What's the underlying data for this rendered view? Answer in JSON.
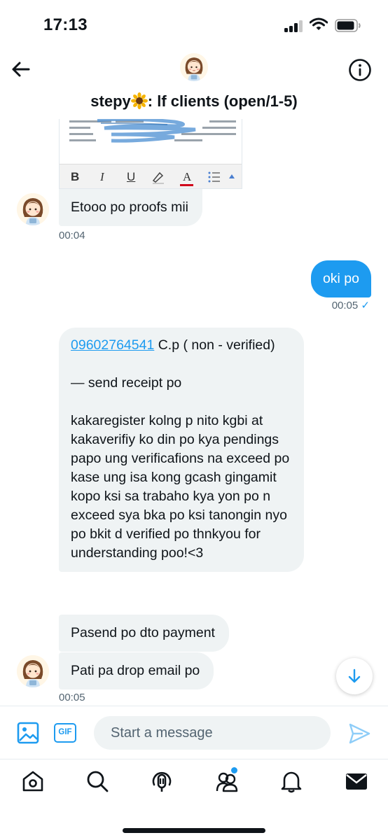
{
  "status_bar": {
    "time": "17:13"
  },
  "header": {
    "title": "stepy",
    "title_suffix": ": lf clients (open/1-5)",
    "title_emoji": "sunflower-icon"
  },
  "doc_preview": {
    "toolbar": [
      "B",
      "I",
      "U",
      "highlight",
      "A",
      "list",
      "caret"
    ]
  },
  "messages": {
    "m1": {
      "text": "Etooo po proofs mii",
      "time": "00:04"
    },
    "m2": {
      "text": "oki po",
      "time": "00:05",
      "status": "✓"
    },
    "m3": {
      "phone": "09602764541",
      "after_phone": " C.p ( non - verified)",
      "body": "— send receipt po\n\nkakaregister kolng p nito kgbi at kakaverifiy ko din po kya pendings papo ung verificafions na exceed po kase ung isa kong gcash gingamit kopo ksi sa trabaho kya yon po n exceed sya bka po ksi tanongin nyo po bkit d verified po thnkyou for understanding poo!<3"
    },
    "m4": {
      "text": "Pasend po dto payment"
    },
    "m5": {
      "text": "Pati pa drop email po",
      "time": "00:05"
    }
  },
  "composer": {
    "placeholder": "Start a message",
    "gif_label": "GIF"
  },
  "tabbar": {
    "items": [
      "home-icon",
      "search-icon",
      "spaces-icon",
      "communities-icon",
      "notifications-icon",
      "messages-icon"
    ],
    "communities_has_badge": true
  },
  "colors": {
    "accent": "#1d9bf0",
    "incoming_bubble": "#eff3f4",
    "text": "#0f1419",
    "muted": "#536471"
  }
}
